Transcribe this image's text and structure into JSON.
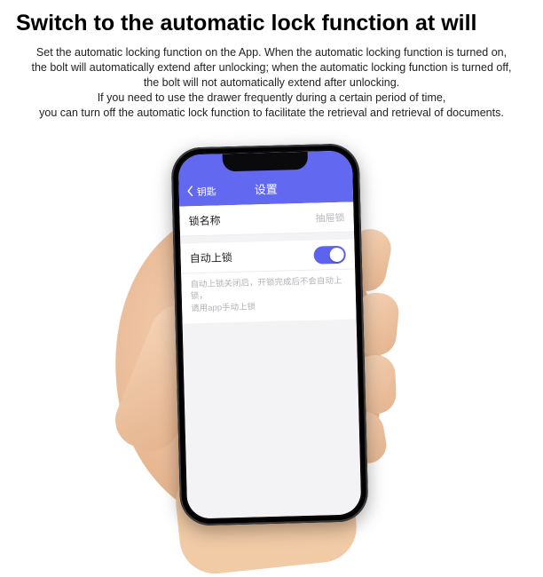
{
  "marketing": {
    "headline": "Switch to the automatic lock function at will",
    "desc_line1": "Set the automatic locking function on the App. When the automatic locking function is turned on,",
    "desc_line2": "the bolt will automatically extend after unlocking; when the automatic locking function is turned off,",
    "desc_line3": "the bolt will not automatically extend after unlocking.",
    "desc_line4": "If you need to use the drawer frequently during a certain period of time,",
    "desc_line5": "you can turn off the automatic lock function to facilitate the retrieval and retrieval of documents."
  },
  "app": {
    "back_label": "钥匙",
    "title": "设置",
    "lock_name": {
      "label": "锁名称",
      "value": "抽屉锁"
    },
    "auto_lock": {
      "label": "自动上锁",
      "enabled": true
    },
    "hint_line1": "自动上锁关闭后，开锁完成后不会自动上锁，",
    "hint_line2": "请用app手动上锁"
  }
}
